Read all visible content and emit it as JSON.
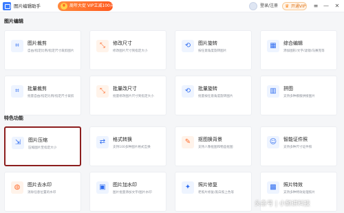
{
  "titlebar": {
    "app_title": "图片编辑助手",
    "promo_badge": "¥",
    "promo_text": "周年大促 VIP立减100元",
    "login": "登录/注册",
    "vip_icon": "♛",
    "vip_label": "开通VIP",
    "menu_icon": "≡",
    "minimize_icon": "—",
    "close_icon": "✕"
  },
  "sections": {
    "editing": "图片编辑",
    "features": "特色功能"
  },
  "cards": [
    {
      "title": "图片裁剪",
      "desc": "自由/指定比例/指定尺寸裁剪图片",
      "glyph": "⌗"
    },
    {
      "title": "修改尺寸",
      "desc": "修改图片尺寸到指定大小",
      "glyph": "⤡"
    },
    {
      "title": "图片旋转",
      "desc": "按任意角度旋转图片",
      "glyph": "⟲"
    },
    {
      "title": "综合编辑",
      "desc": "添加图形/文字/滤镜/马赛克等",
      "glyph": "▦"
    },
    {
      "title": "批量裁剪",
      "desc": "批量自由/指定比例/指定尺寸裁剪",
      "glyph": "⌗"
    },
    {
      "title": "批量改尺寸",
      "desc": "批量修改图片尺寸到指定大小",
      "glyph": "⤡"
    },
    {
      "title": "批量旋转",
      "desc": "批量按任意角度旋转图片",
      "glyph": "⟲"
    },
    {
      "title": "拼图",
      "desc": "支持多种模版拼接图片",
      "glyph": "▥"
    },
    {
      "title": "图片压缩",
      "desc": "压缩图片至指定大小",
      "glyph": "⇲"
    },
    {
      "title": "格式转换",
      "desc": "支持100多种图片格式互换",
      "glyph": "⇄"
    },
    {
      "title": "抠图换背景",
      "desc": "支持人像抠图和物品抠图",
      "glyph": "✎"
    },
    {
      "title": "智能证件照",
      "desc": "支持多种尺寸证件照",
      "glyph": "☺"
    },
    {
      "title": "图片去水印",
      "desc": "消除任意位置的水印",
      "glyph": "◍"
    },
    {
      "title": "图片加水印",
      "desc": "图片批量添加文字/图片水印",
      "glyph": "▣"
    },
    {
      "title": "照片修复",
      "desc": "老照片修复/黑白照上色等",
      "glyph": "✦"
    },
    {
      "title": "照片特效",
      "desc": "支持多种特效处理照片",
      "glyph": "▩"
    }
  ],
  "watermark": "头条号 | 小颜讲科技",
  "colors": {
    "primary": "#2f6cf0",
    "accent_orange": "#ff6a2a",
    "selected_border": "#8c1d1d"
  }
}
